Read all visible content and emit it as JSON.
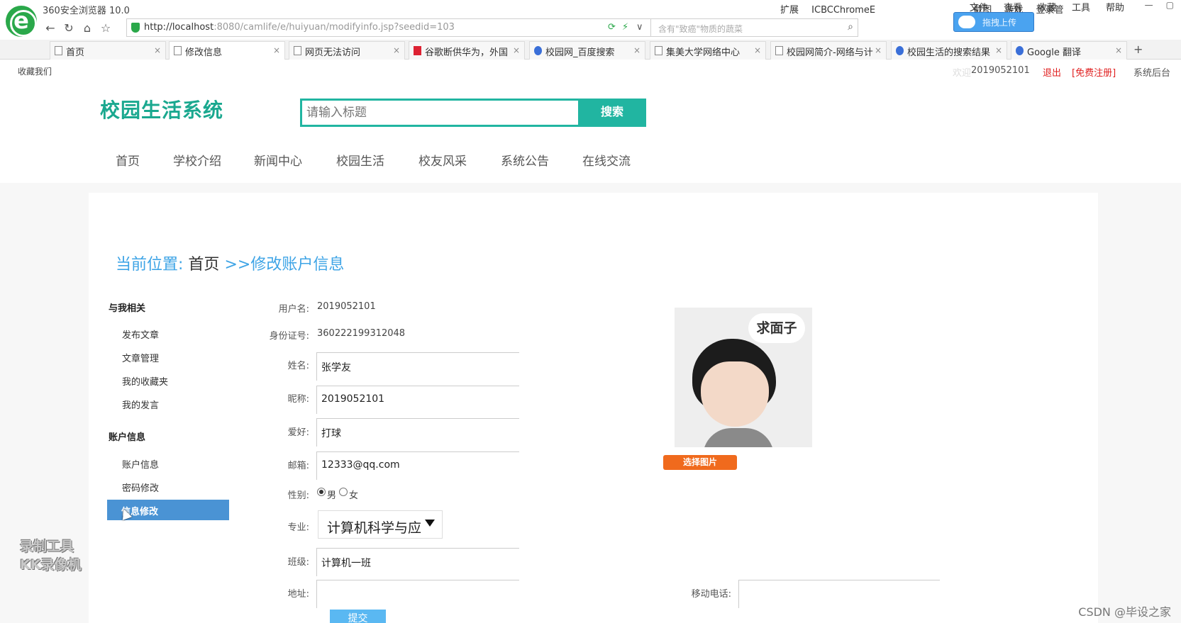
{
  "browser": {
    "title": "360安全浏览器 10.0",
    "menu": [
      "文件",
      "查看",
      "收藏",
      "工具",
      "帮助"
    ],
    "url_host": "http://localhost",
    "url_rest": ":8080/camlife/e/huiyuan/modifyinfo.jsp?seedid=103",
    "search_placeholder": "含有\"致癌\"物质的蔬菜",
    "tools": [
      "扩展",
      "ICBCChromeE",
      "截图",
      "游戏",
      "登录管"
    ],
    "upload_label": "拖拽上传",
    "tabs": [
      {
        "label": "首页",
        "icon": "page"
      },
      {
        "label": "修改信息",
        "icon": "page",
        "active": true
      },
      {
        "label": "网页无法访问",
        "icon": "page"
      },
      {
        "label": "谷歌断供华为，外国",
        "icon": "red"
      },
      {
        "label": "校园网_百度搜索",
        "icon": "blue"
      },
      {
        "label": "集美大学网络中心",
        "icon": "page"
      },
      {
        "label": "校园网简介-网络与计",
        "icon": "page"
      },
      {
        "label": "校园生活的搜索结果",
        "icon": "blue"
      },
      {
        "label": "Google 翻译",
        "icon": "blue"
      }
    ],
    "fav_label": "收藏我们"
  },
  "userbar": {
    "welcome": "欢迎",
    "user": "2019052101",
    "logout": "退出",
    "register": "[免费注册]",
    "admin": "系统后台"
  },
  "site": {
    "title": "校园生活系统",
    "search_placeholder": "请输入标题",
    "search_btn": "搜索",
    "nav": [
      "首页",
      "学校介绍",
      "新闻中心",
      "校园生活",
      "校友风采",
      "系统公告",
      "在线交流"
    ]
  },
  "breadcrumb": {
    "prefix": "当前位置:",
    "home": "首页",
    "sep": ">>",
    "current": "修改账户信息"
  },
  "sidebar": {
    "section1": "与我相关",
    "items1": [
      "发布文章",
      "文章管理",
      "我的收藏夹",
      "我的发言"
    ],
    "section2": "账户信息",
    "items2": [
      "账户信息",
      "密码修改",
      "信息修改"
    ]
  },
  "form": {
    "username_label": "用户名:",
    "username": "2019052101",
    "idcard_label": "身份证号:",
    "idcard": "360222199312048",
    "name_label": "姓名:",
    "name": "张学友",
    "nickname_label": "昵称:",
    "nickname": "2019052101",
    "hobby_label": "爱好:",
    "hobby": "打球",
    "email_label": "邮箱:",
    "email": "12333@qq.com",
    "gender_label": "性别:",
    "gender_male": "男",
    "gender_female": "女",
    "major_label": "专业:",
    "major": "计算机科学与应",
    "class_label": "班级:",
    "class": "计算机一班",
    "address_label": "地址:",
    "address": "",
    "mobile_label": "移动电话:",
    "mobile": "",
    "submit": "提交"
  },
  "avatar": {
    "bubble": "求面子",
    "choose_btn": "选择图片"
  },
  "watermark": {
    "line1": "录制工具",
    "line2": "KK录像机"
  },
  "csdn": "CSDN @毕设之家"
}
